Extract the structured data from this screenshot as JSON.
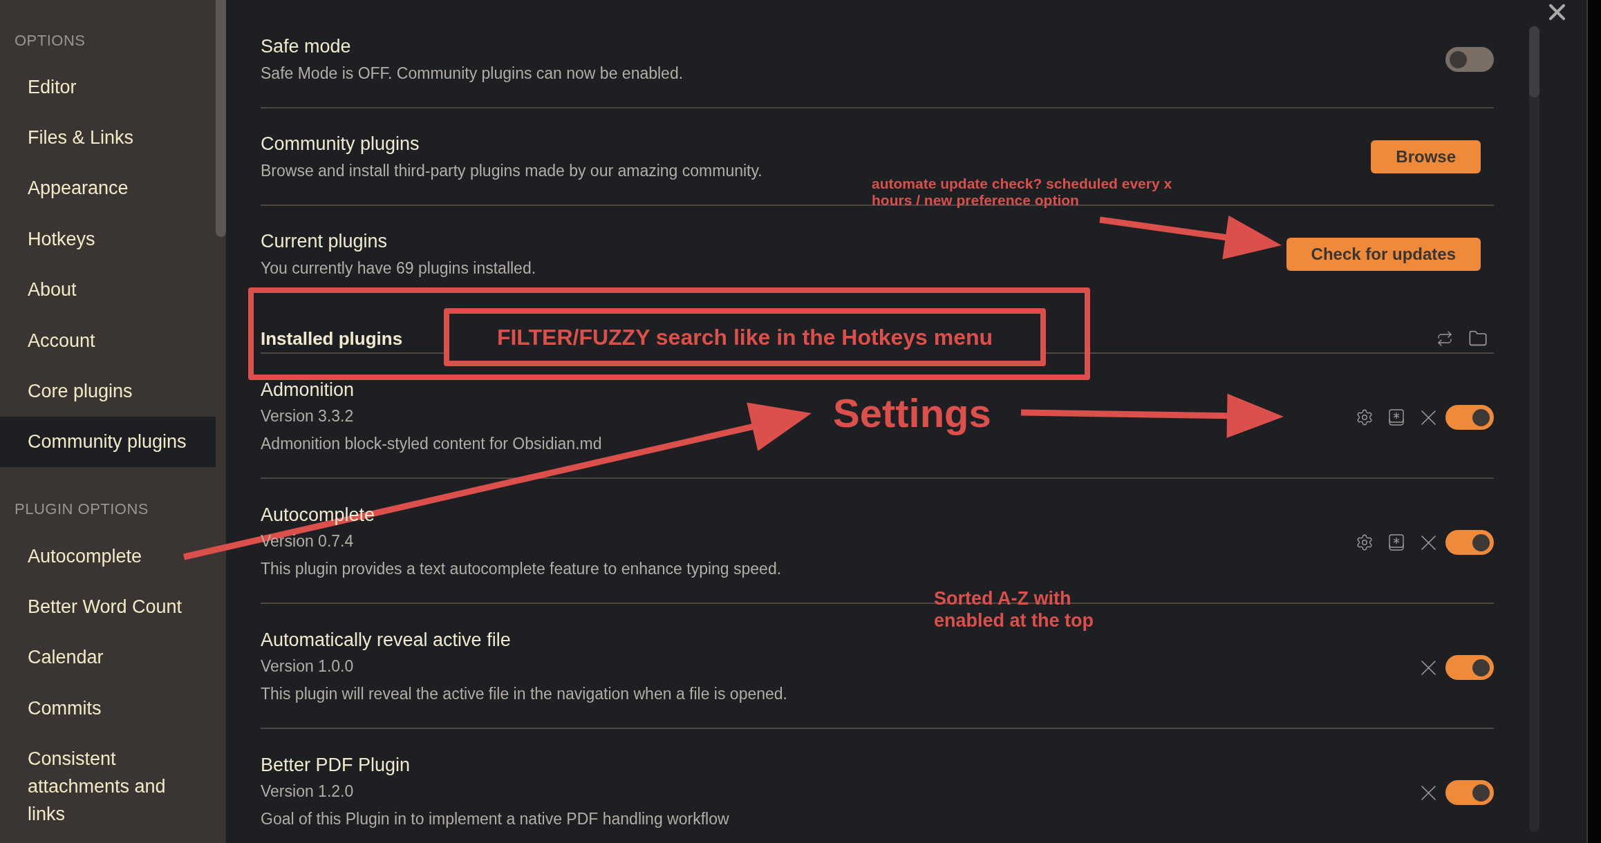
{
  "sidebar": {
    "sections": [
      {
        "heading": "OPTIONS",
        "items": [
          {
            "label": "Editor",
            "selected": false
          },
          {
            "label": "Files & Links",
            "selected": false
          },
          {
            "label": "Appearance",
            "selected": false
          },
          {
            "label": "Hotkeys",
            "selected": false
          },
          {
            "label": "About",
            "selected": false
          },
          {
            "label": "Account",
            "selected": false
          },
          {
            "label": "Core plugins",
            "selected": false
          },
          {
            "label": "Community plugins",
            "selected": true
          }
        ]
      },
      {
        "heading": "PLUGIN OPTIONS",
        "items": [
          {
            "label": "Autocomplete",
            "selected": false
          },
          {
            "label": "Better Word Count",
            "selected": false
          },
          {
            "label": "Calendar",
            "selected": false
          },
          {
            "label": "Commits",
            "selected": false
          },
          {
            "label": "Consistent attachments and links",
            "selected": false
          }
        ]
      }
    ]
  },
  "settings": [
    {
      "title": "Safe mode",
      "description": "Safe Mode is OFF. Community plugins can now be enabled.",
      "kind": "toggle",
      "on": false
    },
    {
      "title": "Community plugins",
      "description": "Browse and install third-party plugins made by our amazing community.",
      "kind": "button",
      "button": "Browse"
    },
    {
      "title": "Current plugins",
      "description": "You currently have 69 plugins installed.",
      "kind": "button",
      "button": "Check for updates"
    }
  ],
  "installed_plugins": {
    "heading": "Installed plugins",
    "plugins": [
      {
        "name": "Admonition",
        "version": "Version 3.3.2",
        "description": "Admonition block-styled content for Obsidian.md",
        "configurable": true,
        "enabled": true
      },
      {
        "name": "Autocomplete",
        "version": "Version 0.7.4",
        "description": "This plugin provides a text autocomplete feature to enhance typing speed.",
        "configurable": true,
        "enabled": true
      },
      {
        "name": "Automatically reveal active file",
        "version": "Version 1.0.0",
        "description": "This plugin will reveal the active file in the navigation when a file is opened.",
        "configurable": false,
        "enabled": true
      },
      {
        "name": "Better PDF Plugin",
        "version": "Version 1.2.0",
        "description": "Goal of this Plugin in to implement a native PDF handling workflow",
        "configurable": false,
        "enabled": true
      }
    ]
  },
  "annotations": {
    "update_note": "automate update check? scheduled every x hours / new preference option",
    "filter_note": "FILTER/FUZZY search like in the Hotkeys menu",
    "settings_label": "Settings",
    "sort_note": "Sorted A-Z with enabled at the top"
  }
}
